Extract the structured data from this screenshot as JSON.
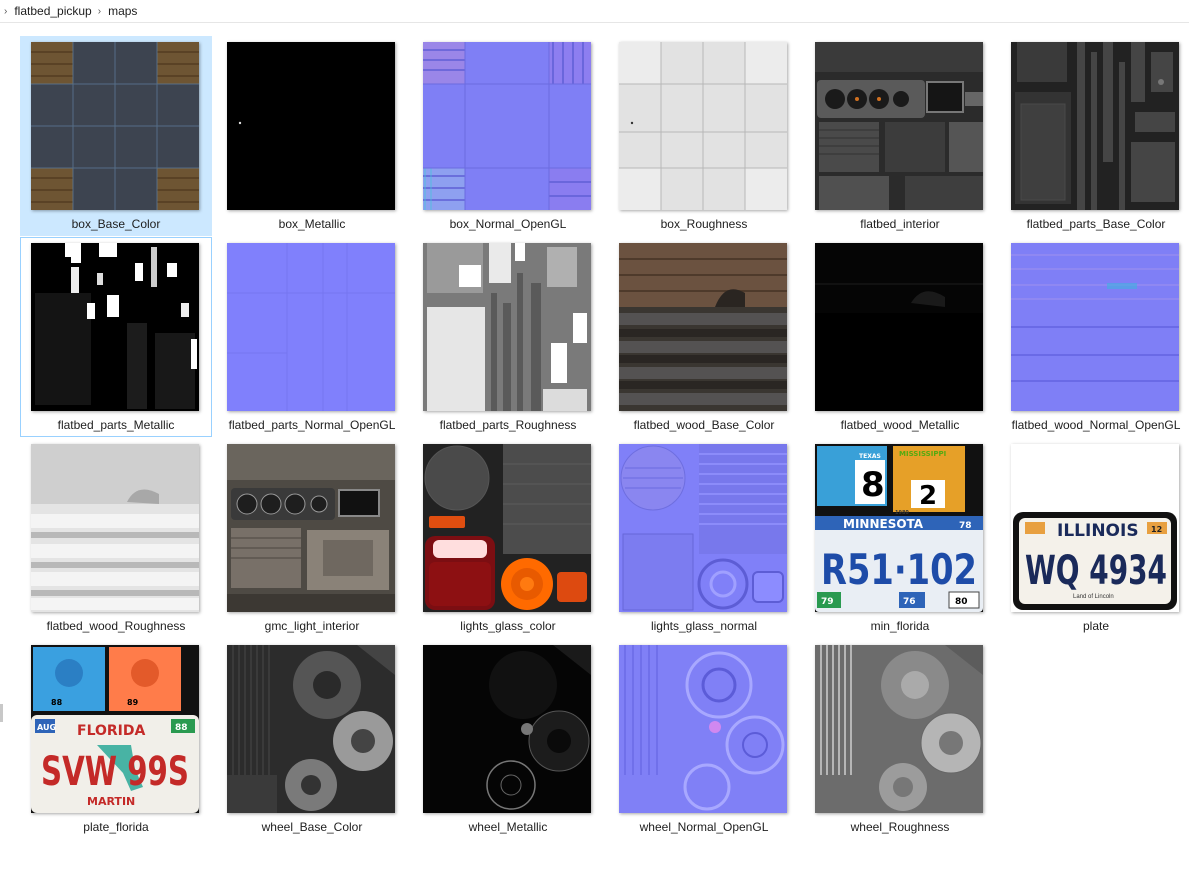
{
  "breadcrumb": {
    "items": [
      "flatbed_pickup",
      "maps"
    ]
  },
  "files": [
    {
      "name": "box_Base_Color",
      "texture": "box-base-color-texture"
    },
    {
      "name": "box_Metallic",
      "texture": "box-metallic-texture"
    },
    {
      "name": "box_Normal_OpenGL",
      "texture": "box-normal-texture"
    },
    {
      "name": "box_Roughness",
      "texture": "box-roughness-texture"
    },
    {
      "name": "flatbed_interior",
      "texture": "interior-texture"
    },
    {
      "name": "flatbed_parts_Base_Color",
      "texture": "parts-base-color-texture"
    },
    {
      "name": "flatbed_parts_Metallic",
      "texture": "parts-metallic-texture"
    },
    {
      "name": "flatbed_parts_Normal_OpenGL",
      "texture": "parts-normal-texture"
    },
    {
      "name": "flatbed_parts_Roughness",
      "texture": "parts-roughness-texture"
    },
    {
      "name": "flatbed_wood_Base_Color",
      "texture": "wood-base-color-texture"
    },
    {
      "name": "flatbed_wood_Metallic",
      "texture": "wood-metallic-texture"
    },
    {
      "name": "flatbed_wood_Normal_OpenGL",
      "texture": "wood-normal-texture"
    },
    {
      "name": "flatbed_wood_Roughness",
      "texture": "wood-roughness-texture"
    },
    {
      "name": "gmc_light_interior",
      "texture": "gmc-interior-texture"
    },
    {
      "name": "lights_glass_color",
      "texture": "lights-color-texture"
    },
    {
      "name": "lights_glass_normal",
      "texture": "lights-normal-texture"
    },
    {
      "name": "min_florida",
      "texture": "license-plates-texture"
    },
    {
      "name": "plate",
      "texture": "illinois-plate-texture"
    },
    {
      "name": "plate_florida",
      "texture": "florida-plate-texture"
    },
    {
      "name": "wheel_Base_Color",
      "texture": "wheel-base-color-texture"
    },
    {
      "name": "wheel_Metallic",
      "texture": "wheel-metallic-texture"
    },
    {
      "name": "wheel_Normal_OpenGL",
      "texture": "wheel-normal-texture"
    },
    {
      "name": "wheel_Roughness",
      "texture": "wheel-roughness-texture"
    }
  ],
  "selected_file": "box_Base_Color",
  "hovered_file": "flatbed_parts_Metallic",
  "thumbnail_text": {
    "min_florida": {
      "texas": "TEXAS",
      "big_digit_1": "8",
      "mississippi": "MISSISSIPPI",
      "big_digit_2": "2",
      "year": "1980",
      "state": "MINNESOTA",
      "number": "R51·102",
      "year_tag": "78",
      "small_1": "79",
      "small_2": "76",
      "small_3": "80"
    },
    "plate": {
      "state": "ILLINOIS",
      "number": "WQ 4934",
      "sticker": "12",
      "motto": "Land of Lincoln"
    },
    "plate_florida": {
      "state": "FLORIDA",
      "number": "SVW 99S",
      "county": "MARTIN",
      "month": "AUG",
      "year": "88",
      "sticker_left": "88",
      "sticker_right": "89"
    }
  },
  "colors": {
    "selection": "#cce8ff",
    "hover_border": "#99d1ff",
    "normal_map": "#8080ff"
  }
}
